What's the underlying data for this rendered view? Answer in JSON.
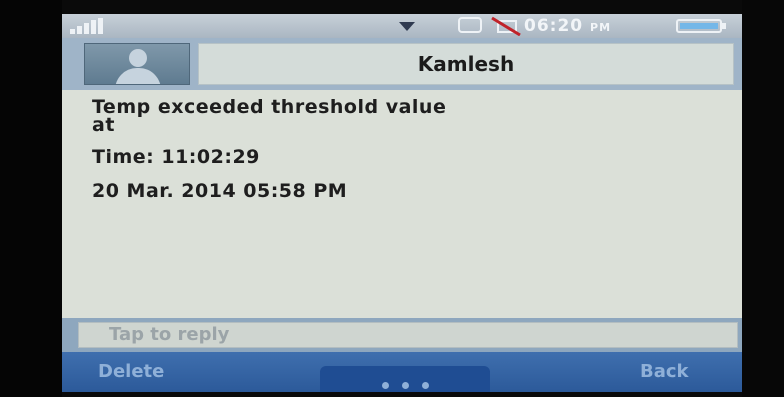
{
  "status_bar": {
    "time": "06:20",
    "am_pm": "PM",
    "signal_icon": "signal-icon",
    "message_icon": "message-icon",
    "mute_icon": "mute-icon",
    "battery_icon": "battery-icon",
    "dropdown_icon": "chevron-down-icon"
  },
  "header": {
    "contact_name": "Kamlesh",
    "avatar_icon": "avatar-icon"
  },
  "message": {
    "line1": "Temp exceeded threshold value",
    "line2": "at",
    "line3": "Time: 11:02:29",
    "line4": "20 Mar. 2014 05:58 PM"
  },
  "reply": {
    "placeholder": "Tap to reply"
  },
  "softkeys": {
    "left_label": "Delete",
    "right_label": "Back",
    "more_icon": "more-dots-icon"
  },
  "colors": {
    "screen_bg": "#dbe0d8",
    "header_bar": "#9fb4c8",
    "softkey_bar": "#2c5a9a",
    "softkey_text": "#8fb0d8"
  }
}
